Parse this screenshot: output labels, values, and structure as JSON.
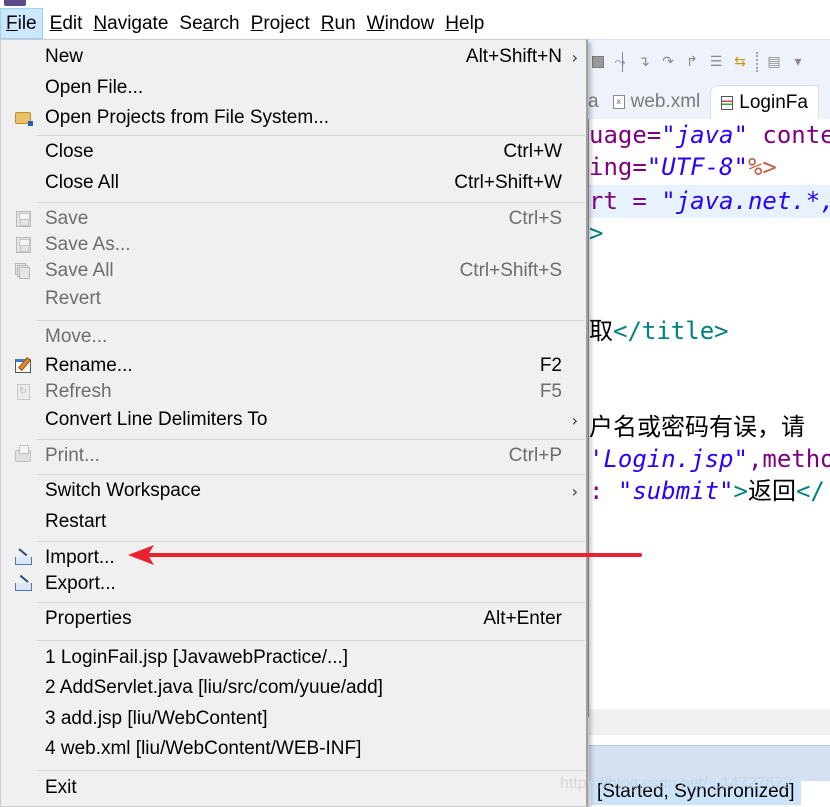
{
  "menubar": {
    "items": [
      {
        "label": "File",
        "mnemonic": "F",
        "rest": "ile",
        "active": true
      },
      {
        "label": "Edit",
        "mnemonic": "E",
        "rest": "dit"
      },
      {
        "label": "Navigate",
        "mnemonic": "N",
        "rest": "avigate"
      },
      {
        "label": "Search",
        "pre": "Se",
        "mnemonic": "a",
        "rest": "rch"
      },
      {
        "label": "Project",
        "mnemonic": "P",
        "rest": "roject"
      },
      {
        "label": "Run",
        "mnemonic": "R",
        "rest": "un"
      },
      {
        "label": "Window",
        "mnemonic": "W",
        "rest": "indow"
      },
      {
        "label": "Help",
        "mnemonic": "H",
        "rest": "elp"
      }
    ]
  },
  "file_menu": {
    "items": [
      {
        "label": "New",
        "accel": "Alt+Shift+N",
        "submenu": true,
        "icon": "none"
      },
      {
        "label": "Open File...",
        "icon": "none"
      },
      {
        "label": "Open Projects from File System...",
        "icon": "folder-icon"
      },
      {
        "label": "Close",
        "accel": "Ctrl+W",
        "icon": "none"
      },
      {
        "label": "Close All",
        "accel": "Ctrl+Shift+W",
        "icon": "none"
      },
      {
        "label": "Save",
        "accel": "Ctrl+S",
        "disabled": true,
        "icon": "save-icon"
      },
      {
        "label": "Save As...",
        "disabled": true,
        "icon": "save-as-icon"
      },
      {
        "label": "Save All",
        "accel": "Ctrl+Shift+S",
        "disabled": true,
        "icon": "save-all-icon"
      },
      {
        "label": "Revert",
        "disabled": true,
        "icon": "none"
      },
      {
        "label": "Move...",
        "disabled": true,
        "icon": "none"
      },
      {
        "label": "Rename...",
        "accel": "F2",
        "icon": "rename-icon"
      },
      {
        "label": "Refresh",
        "accel": "F5",
        "disabled": true,
        "icon": "refresh-icon"
      },
      {
        "label": "Convert Line Delimiters To",
        "submenu": true,
        "icon": "none"
      },
      {
        "label": "Print...",
        "accel": "Ctrl+P",
        "disabled": true,
        "icon": "print-icon"
      },
      {
        "label": "Switch Workspace",
        "submenu": true,
        "icon": "none"
      },
      {
        "label": "Restart",
        "icon": "none"
      },
      {
        "label": "Import...",
        "icon": "import-icon"
      },
      {
        "label": "Export...",
        "icon": "export-icon"
      },
      {
        "label": "Properties",
        "accel": "Alt+Enter",
        "icon": "none"
      },
      {
        "label": "1 LoginFail.jsp  [JavawebPractice/...]",
        "icon": "none"
      },
      {
        "label": "2 AddServlet.java  [liu/src/com/yuue/add]",
        "icon": "none"
      },
      {
        "label": "3 add.jsp  [liu/WebContent]",
        "icon": "none"
      },
      {
        "label": "4 web.xml  [liu/WebContent/WEB-INF]",
        "icon": "none"
      },
      {
        "label": "Exit",
        "icon": "none"
      }
    ]
  },
  "editor": {
    "tabs": [
      {
        "label": "a",
        "partial": true
      },
      {
        "label": "web.xml",
        "icon": "xml-file-icon"
      },
      {
        "label": "LoginFa",
        "icon": "jsp-file-icon",
        "active": true
      }
    ],
    "code_lines": [
      {
        "parts": [
          [
            "c-attr",
            "uage="
          ],
          [
            "c-str",
            "\"java\""
          ],
          [
            "c-attr",
            " conte"
          ]
        ]
      },
      {
        "parts": [
          [
            "c-attr",
            "ing="
          ],
          [
            "c-str",
            "\"UTF-8\""
          ],
          [
            "c-pct",
            "%>"
          ]
        ]
      },
      {
        "parts": [
          [
            "c-attr",
            "rt = "
          ],
          [
            "c-str",
            "\"java.net.*,"
          ]
        ],
        "highlighted": true
      },
      {
        "parts": [
          [
            "c-tag",
            ">"
          ]
        ]
      },
      {
        "parts": [
          [
            "c-txt",
            "取"
          ],
          [
            "c-tag",
            "</title>"
          ]
        ]
      },
      {
        "parts": [
          [
            "c-txt",
            "户名或密码有误，请"
          ]
        ]
      },
      {
        "parts": [
          [
            "c-str",
            "'Login.jsp\""
          ],
          [
            "c-attr",
            ",metho"
          ]
        ]
      },
      {
        "parts": [
          [
            "c-attr",
            ": "
          ],
          [
            "c-str",
            "\"submit\""
          ],
          [
            "c-tag",
            ">"
          ],
          [
            "c-txt",
            "返回"
          ],
          [
            "c-tag",
            "</"
          ]
        ]
      }
    ],
    "status": "[Started, Synchronized]"
  },
  "annotation": {
    "color": "#e8222e",
    "points_to": "Import..."
  },
  "watermark": "https://blog.csdn.net/...14727672"
}
